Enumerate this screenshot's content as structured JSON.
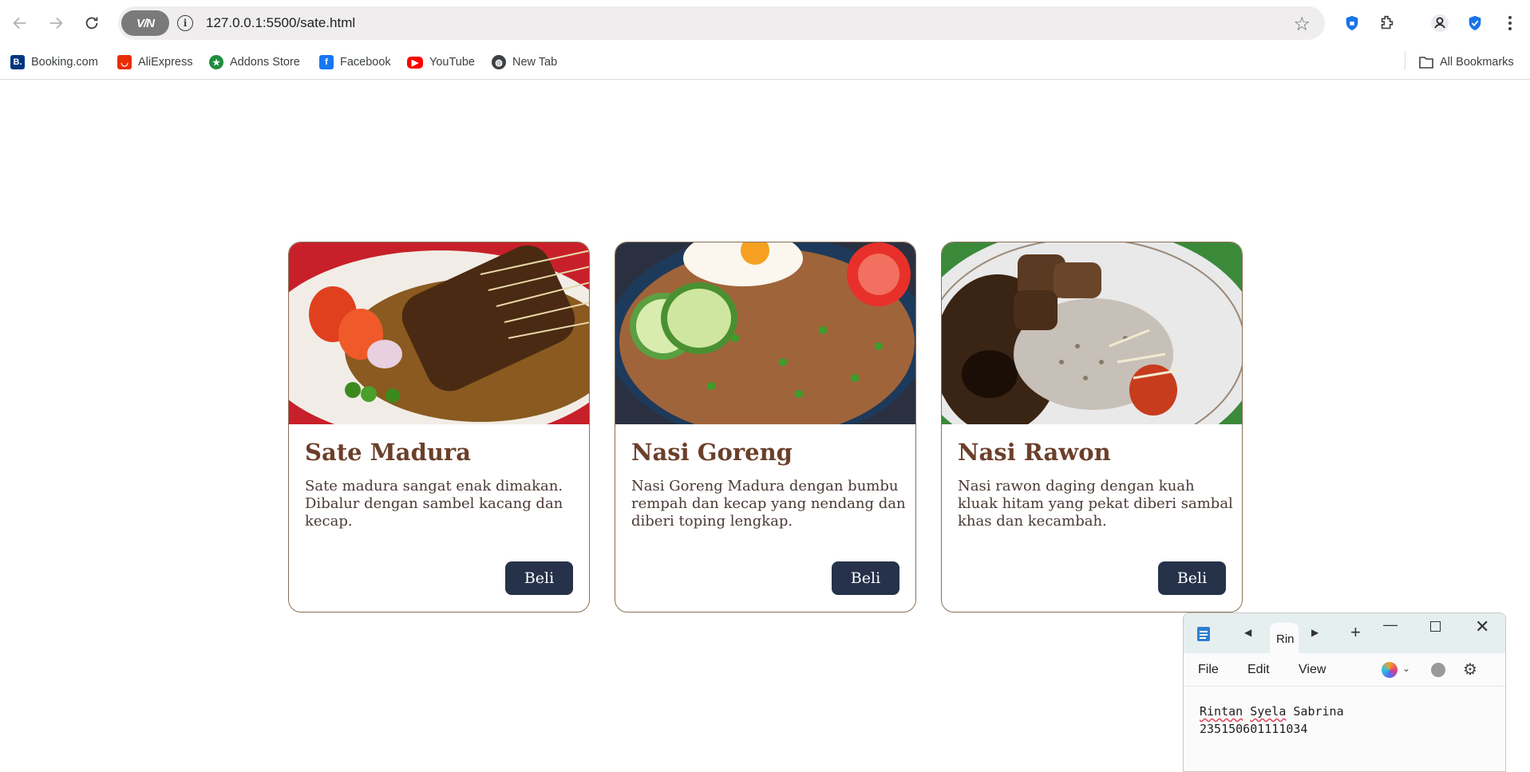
{
  "browser": {
    "url": "127.0.0.1:5500/sate.html",
    "vpn_label": "V/N",
    "bookmarks": [
      {
        "label": "Booking.com",
        "icon": "booking-icon",
        "color": "#003580"
      },
      {
        "label": "AliExpress",
        "icon": "aliexpress-icon",
        "color": "#e62e04"
      },
      {
        "label": "Addons Store",
        "icon": "addons-icon",
        "color": "#1e8e3e"
      },
      {
        "label": "Facebook",
        "icon": "facebook-icon",
        "color": "#1877f2"
      },
      {
        "label": "YouTube",
        "icon": "youtube-icon",
        "color": "#ff0000"
      },
      {
        "label": "New Tab",
        "icon": "globe-icon",
        "color": "#3c4043"
      }
    ],
    "all_bookmarks": "All Bookmarks"
  },
  "cards": [
    {
      "title": "Sate Madura",
      "desc": "Sate madura sangat enak dimakan. Dibalur dengan sambel kacang dan kecap.",
      "button": "Beli"
    },
    {
      "title": "Nasi Goreng",
      "desc": "Nasi Goreng Madura dengan bumbu rempah dan kecap yang nendang dan diberi toping lengkap.",
      "button": "Beli"
    },
    {
      "title": "Nasi Rawon",
      "desc": "Nasi rawon daging dengan kuah kluak hitam yang pekat diberi sambal khas dan kecambah.",
      "button": "Beli"
    }
  ],
  "notepad": {
    "tab_label": "Rin",
    "menu": [
      "File",
      "Edit",
      "View"
    ],
    "line1_word1": "Rintan",
    "line1_word2": "Syela",
    "line1_word3": "Sabrina",
    "line2": "235150601111034"
  },
  "colors": {
    "accent_button": "#26324a",
    "card_title": "#6b3f2a",
    "card_border": "#8b6f55"
  }
}
